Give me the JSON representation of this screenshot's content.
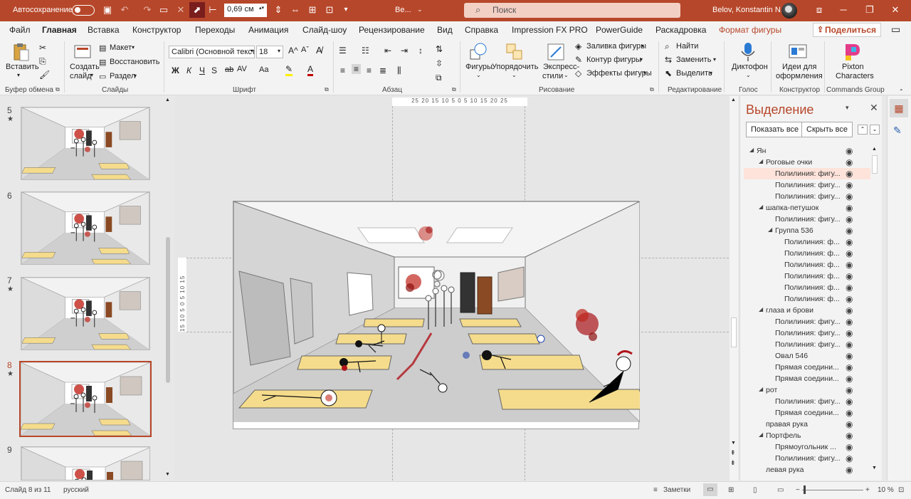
{
  "titlebar": {
    "autosave_label": "Автосохранение",
    "zoom_value": "0,69 см",
    "file_name": "Ве...",
    "search_placeholder": "Поиск",
    "user_name": "Belov, Konstantin N."
  },
  "menu": {
    "tabs": [
      "Файл",
      "Главная",
      "Вставка",
      "Конструктор",
      "Переходы",
      "Анимация",
      "Слайд-шоу",
      "Рецензирование",
      "Вид",
      "Справка",
      "Impression FX PRO",
      "PowerGuide",
      "Раскадровка",
      "Формат фигуры"
    ],
    "active": "Главная",
    "share_label": "Поделиться"
  },
  "ribbon": {
    "paste": "Вставить",
    "new_slide_1": "Создать",
    "new_slide_2": "слайд",
    "layout": "Макет",
    "reset": "Восстановить",
    "section": "Раздел",
    "font_name": "Calibri (Основной текст)",
    "font_size": "18",
    "shapes": "Фигуры",
    "arrange": "Упорядочить",
    "quick_styles_1": "Экспресс-",
    "quick_styles_2": "стили",
    "shape_fill": "Заливка фигуры",
    "shape_outline": "Контур фигуры",
    "shape_effects": "Эффекты фигуры",
    "find": "Найти",
    "replace": "Заменить",
    "select": "Выделить",
    "dictate": "Диктофон",
    "designer_1": "Идеи для",
    "designer_2": "оформления",
    "pixton_1": "Pixton",
    "pixton_2": "Characters",
    "groups": {
      "clipboard": "Буфер обмена",
      "slides": "Слайды",
      "font": "Шрифт",
      "paragraph": "Абзац",
      "drawing": "Рисование",
      "editing": "Редактирование",
      "voice": "Голос",
      "designer": "Конструктор",
      "commands": "Commands Group"
    }
  },
  "thumbnails": [
    {
      "num": "5",
      "star": "★"
    },
    {
      "num": "6",
      "star": ""
    },
    {
      "num": "7",
      "star": "★"
    },
    {
      "num": "8",
      "star": "★"
    },
    {
      "num": "9",
      "star": ""
    }
  ],
  "ruler": {
    "horizontal": "25 20 15 10 5 0 5 10 15 20 25",
    "vertical": "15 10 5 0 5 10 15"
  },
  "selection_pane": {
    "title": "Выделение",
    "show_all": "Показать все",
    "hide_all": "Скрыть все",
    "items": [
      {
        "label": "Ян",
        "level": 0,
        "arrow": true
      },
      {
        "label": "Роговые очки",
        "level": 1,
        "arrow": true
      },
      {
        "label": "Полилиния: фигу...",
        "level": 2,
        "arrow": false,
        "highlight": true
      },
      {
        "label": "Полилиния: фигу...",
        "level": 2,
        "arrow": false
      },
      {
        "label": "Полилиния: фигу...",
        "level": 2,
        "arrow": false
      },
      {
        "label": "шапка-петушок",
        "level": 1,
        "arrow": true
      },
      {
        "label": "Полилиния: фигу...",
        "level": 2,
        "arrow": false
      },
      {
        "label": "Группа 536",
        "level": 2,
        "arrow": true
      },
      {
        "label": "Полилиния: ф...",
        "level": 3,
        "arrow": false
      },
      {
        "label": "Полилиния: ф...",
        "level": 3,
        "arrow": false
      },
      {
        "label": "Полилиния: ф...",
        "level": 3,
        "arrow": false
      },
      {
        "label": "Полилиния: ф...",
        "level": 3,
        "arrow": false
      },
      {
        "label": "Полилиния: ф...",
        "level": 3,
        "arrow": false
      },
      {
        "label": "Полилиния: ф...",
        "level": 3,
        "arrow": false
      },
      {
        "label": "глаза и брови",
        "level": 1,
        "arrow": true
      },
      {
        "label": "Полилиния: фигу...",
        "level": 2,
        "arrow": false
      },
      {
        "label": "Полилиния: фигу...",
        "level": 2,
        "arrow": false
      },
      {
        "label": "Полилиния: фигу...",
        "level": 2,
        "arrow": false
      },
      {
        "label": "Овал 546",
        "level": 2,
        "arrow": false
      },
      {
        "label": "Прямая соедини...",
        "level": 2,
        "arrow": false
      },
      {
        "label": "Прямая соедини...",
        "level": 2,
        "arrow": false
      },
      {
        "label": "рот",
        "level": 1,
        "arrow": true
      },
      {
        "label": "Полилиния: фигу...",
        "level": 2,
        "arrow": false
      },
      {
        "label": "Прямая соедини...",
        "level": 2,
        "arrow": false
      },
      {
        "label": "правая рука",
        "level": 1,
        "arrow": false
      },
      {
        "label": "Портфель",
        "level": 1,
        "arrow": true
      },
      {
        "label": "Прямоугольник ...",
        "level": 2,
        "arrow": false
      },
      {
        "label": "Полилиния: фигу...",
        "level": 2,
        "arrow": false
      },
      {
        "label": "левая рука",
        "level": 1,
        "arrow": false
      }
    ]
  },
  "status": {
    "slide_counter": "Слайд 8 из 11",
    "language": "русский",
    "notes": "Заметки",
    "zoom_percent": "10 %"
  },
  "colors": {
    "accent": "#b7472a",
    "desk": "#f5dc8c",
    "blood": "#b0141a"
  }
}
